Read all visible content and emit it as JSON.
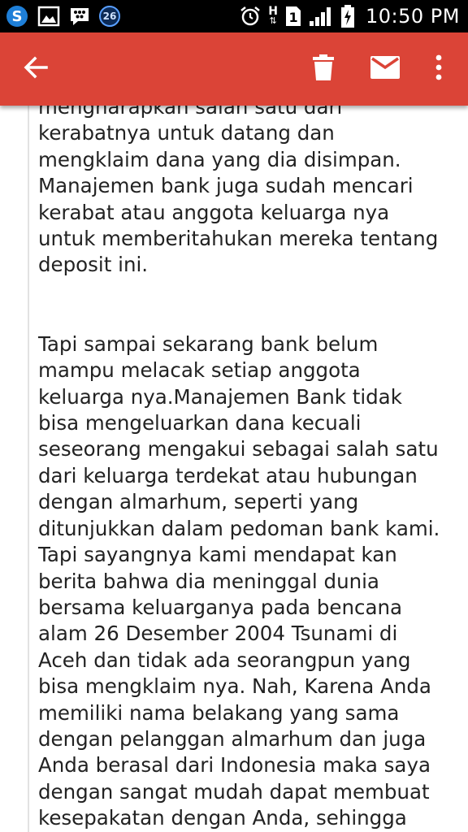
{
  "status_bar": {
    "notification_badge": "26",
    "network_type": "H",
    "sim_slot": "1",
    "time": "10:50 PM"
  },
  "app_bar": {
    "background_color": "#db4437",
    "icons": [
      "back-arrow-icon",
      "delete-icon",
      "mail-icon",
      "more-vert-icon"
    ]
  },
  "email_body": {
    "paragraph_1_lines": [
      "mengharapkan salah satu dari",
      "kerabatnya untuk datang dan",
      "mengklaim dana yang dia disimpan.",
      "Manajemen bank juga sudah mencari",
      "kerabat atau anggota keluarga nya",
      "untuk memberitahukan mereka tentang",
      "deposit ini."
    ],
    "paragraph_2_lines": [
      "Tapi sampai sekarang bank belum",
      "mampu melacak setiap anggota",
      "keluarga nya.Manajemen Bank tidak",
      "bisa mengeluarkan dana kecuali",
      "seseorang mengakui sebagai salah satu",
      "dari keluarga terdekat atau hubungan",
      "dengan almarhum, seperti yang",
      "ditunjukkan dalam pedoman bank kami.",
      "Tapi sayangnya kami mendapat kan",
      "berita bahwa dia meninggal dunia",
      "bersama keluarganya pada bencana",
      "alam 26 Desember 2004 Tsunami di",
      "Aceh dan tidak ada seorangpun yang",
      "bisa mengklaim nya. Nah, Karena Anda",
      "memiliki nama belakang yang sama",
      "dengan pelanggan almarhum dan juga",
      "Anda berasal dari Indonesia maka saya",
      "dengan sangat mudah dapat membuat",
      "kesepakatan dengan Anda, sehingga"
    ]
  }
}
